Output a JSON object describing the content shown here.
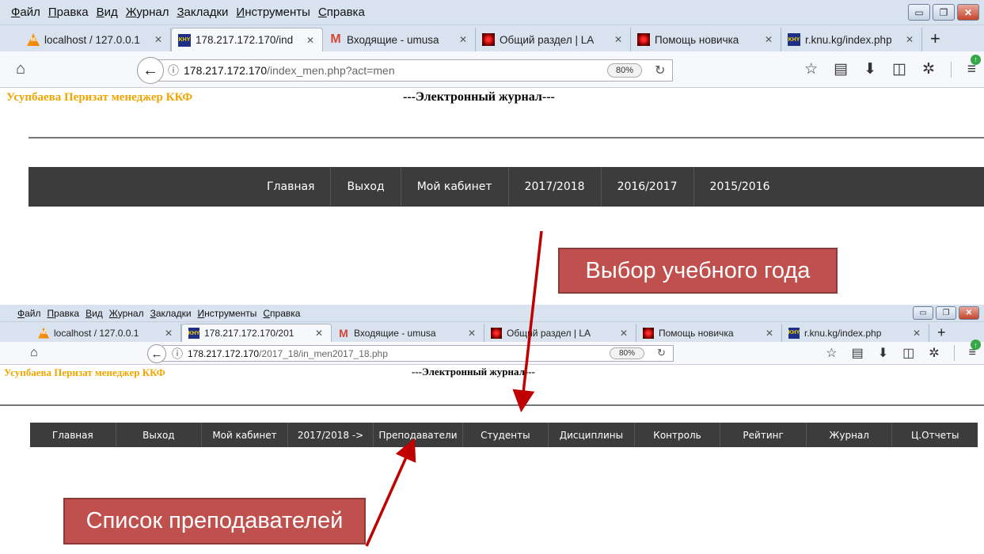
{
  "browser_menu": [
    "Файл",
    "Правка",
    "Вид",
    "Журнал",
    "Закладки",
    "Инструменты",
    "Справка"
  ],
  "window_controls": {
    "minimize": "▭",
    "maximize": "❐",
    "close": "✕"
  },
  "screen1": {
    "tabs": [
      {
        "favicon": "pma-icon",
        "title": "localhost / 127.0.0.1",
        "active": false
      },
      {
        "favicon": "knu-icon",
        "title": "178.217.172.170/ind",
        "active": true
      },
      {
        "favicon": "gmail-icon",
        "title": "Входящие - umusa",
        "active": false
      },
      {
        "favicon": "red-icon",
        "title": "Общий раздел | LA",
        "active": false
      },
      {
        "favicon": "red-icon",
        "title": "Помощь новичка",
        "active": false
      },
      {
        "favicon": "knu-icon",
        "title": "r.knu.kg/index.php",
        "active": false
      }
    ],
    "url_host": "178.217.172.170",
    "url_path": "/index_men.php?act=men",
    "zoom": "80%",
    "owner": "Усупбаева Перизат менеджер ККФ",
    "title": "---Электронный журнал---",
    "nav": [
      "Главная",
      "Выход",
      "Мой кабинет",
      "2017/2018",
      "2016/2017",
      "2015/2016"
    ]
  },
  "screen2": {
    "tabs": [
      {
        "favicon": "pma-icon",
        "title": "localhost / 127.0.0.1",
        "active": false
      },
      {
        "favicon": "knu-icon",
        "title": "178.217.172.170/201",
        "active": true
      },
      {
        "favicon": "gmail-icon",
        "title": "Входящие - umusa",
        "active": false
      },
      {
        "favicon": "red-icon",
        "title": "Общий раздел | LA",
        "active": false
      },
      {
        "favicon": "red-icon",
        "title": "Помощь новичка",
        "active": false
      },
      {
        "favicon": "knu-icon",
        "title": "r.knu.kg/index.php",
        "active": false
      }
    ],
    "url_host": "178.217.172.170",
    "url_path": "/2017_18/in_men2017_18.php",
    "zoom": "80%",
    "owner": "Усупбаева Перизат менеджер ККФ",
    "title": "---Электронный журнал---",
    "nav": [
      "Главная",
      "Выход",
      "Мой кабинет",
      "2017/2018 ->",
      "Преподаватели",
      "Студенты",
      "Дисциплины",
      "Контроль",
      "Рейтинг",
      "Журнал",
      "Ц.Отчеты"
    ]
  },
  "annotations": {
    "year_choice": "Выбор  учебного года",
    "teachers_list": "Список преподавателей"
  },
  "colors": {
    "callout_bg": "#c0504d",
    "arrow": "#c00000",
    "owner_text": "#f0a500",
    "nav_bg": "#3c3c3c"
  }
}
